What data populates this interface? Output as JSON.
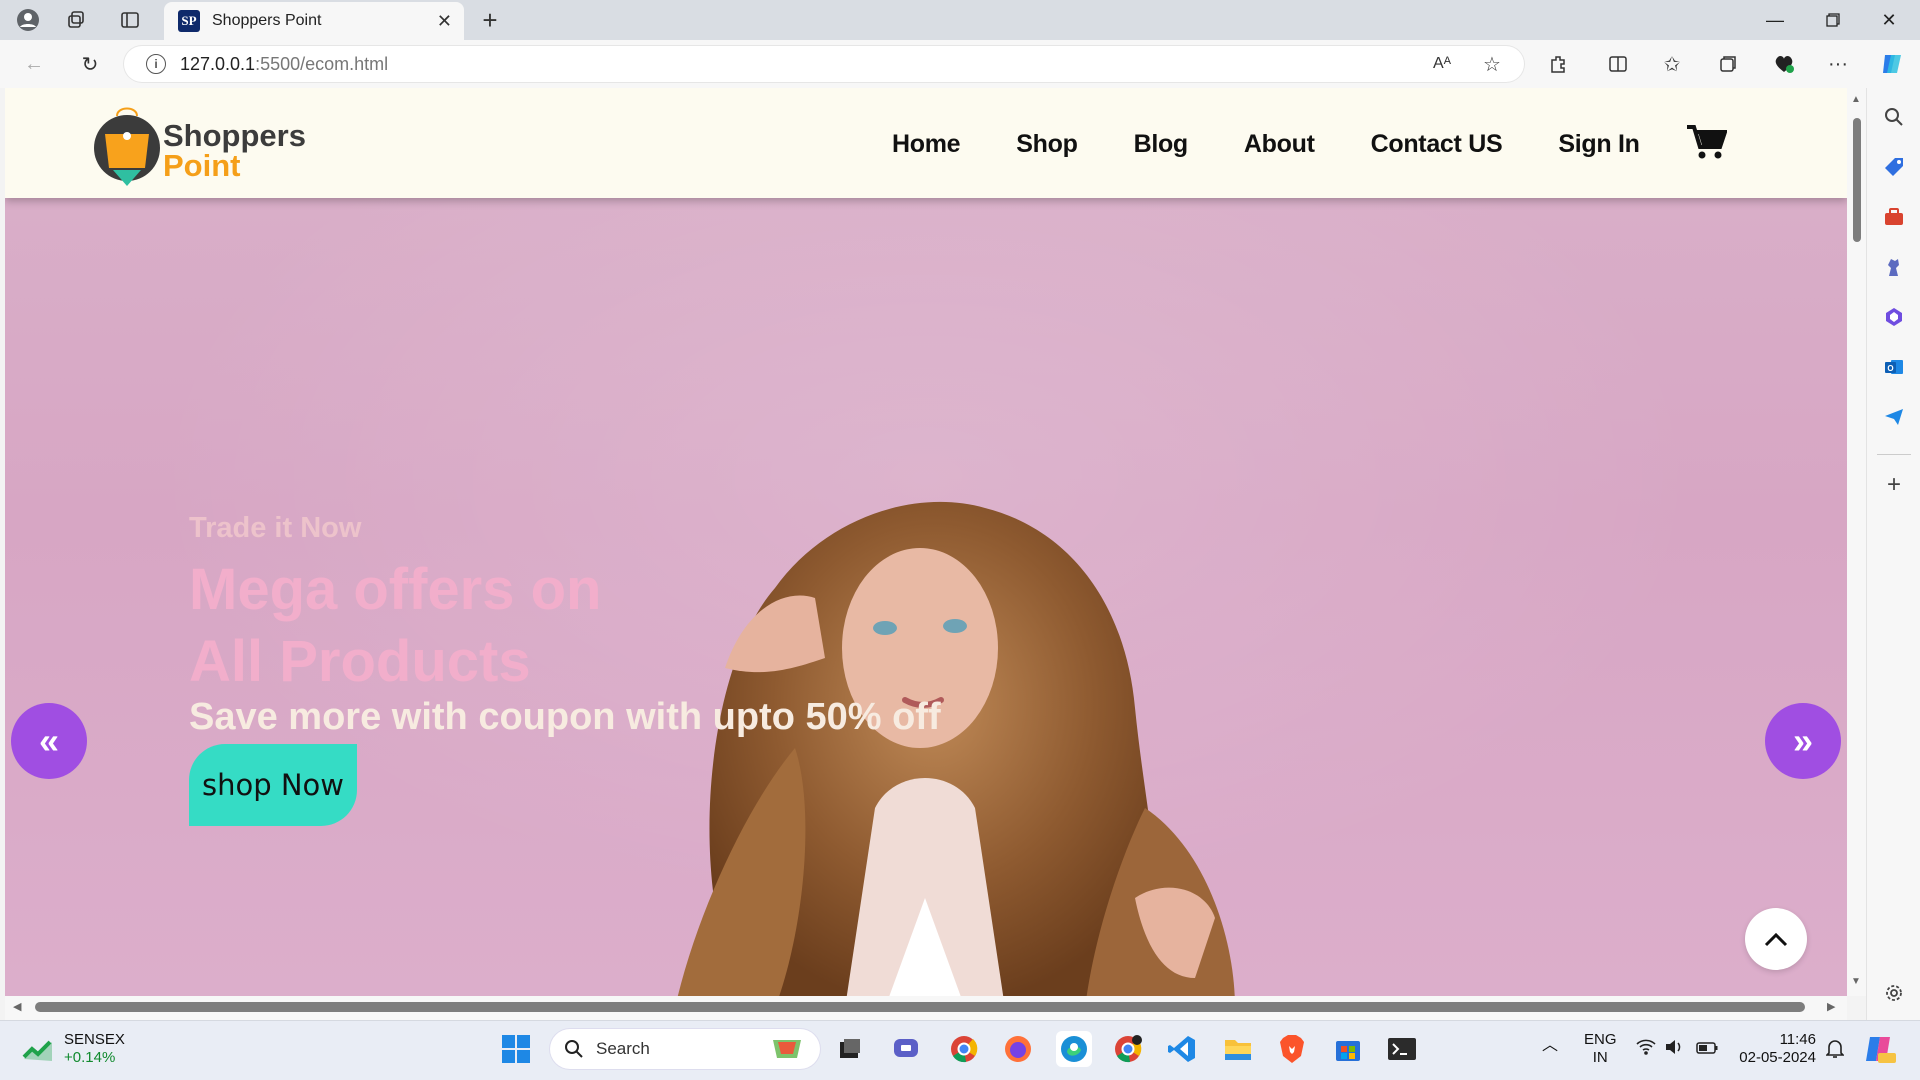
{
  "browser": {
    "tab_title": "Shoppers Point",
    "tab_favicon_text": "SP",
    "url_host": "127.0.0.1",
    "url_path": ":5500/ecom.html"
  },
  "site": {
    "logo_line1": "Shoppers",
    "logo_line2": "Point",
    "nav": [
      "Home",
      "Shop",
      "Blog",
      "About",
      "Contact US",
      "Sign In"
    ]
  },
  "hero": {
    "tagline": "Trade it Now",
    "headline_line1": "Mega offers on",
    "headline_line2": "All Products",
    "subline": "Save more with coupon with upto 50% off",
    "cta": "shop Now",
    "prev_glyph": "«",
    "next_glyph": "»"
  },
  "taskbar": {
    "ticker_name": "SENSEX",
    "ticker_change": "+0.14%",
    "search_placeholder": "Search",
    "lang_top": "ENG",
    "lang_bottom": "IN",
    "time": "11:46",
    "date": "02-05-2024"
  },
  "colors": {
    "accent_purple": "#a04ee2",
    "cta_teal": "#35dcc5",
    "logo_orange": "#f59f19",
    "hero_pink": "#d9aec8",
    "navbar_bg": "#fdfbf0"
  }
}
